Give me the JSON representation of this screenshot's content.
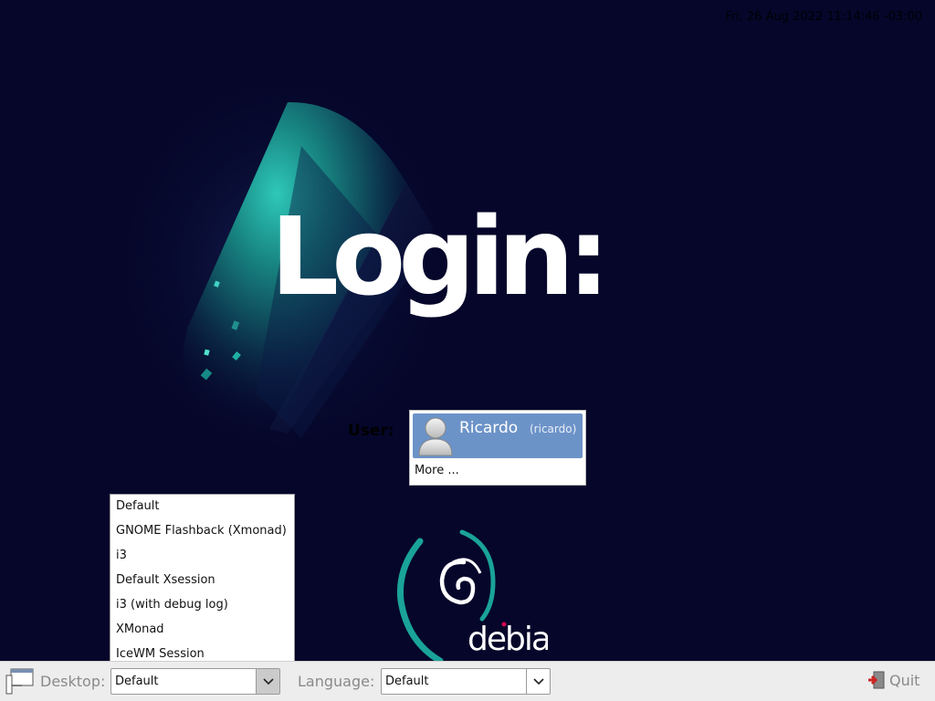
{
  "clock": "Fri, 26 Aug 2022 11:14:46 -03:00",
  "login_title": "Login:",
  "user_label": "User:",
  "user_list": {
    "selected_user": {
      "name": "Ricardo",
      "login": "(ricardo)"
    },
    "more_label": "More ..."
  },
  "session_menu": {
    "items": [
      "Default",
      "GNOME Flashback (Xmonad)",
      "i3",
      "Default Xsession",
      "i3 (with debug log)",
      "XMonad",
      "IceWM Session"
    ]
  },
  "bottom_bar": {
    "desktop_label": "Desktop:",
    "desktop_value": "Default",
    "language_label": "Language:",
    "language_value": "Default",
    "quit_label": "Quit"
  },
  "logo_text": "debian",
  "icons": {
    "panel": "panel-window-icon",
    "avatar": "user-avatar-icon",
    "quit": "exit-door-icon",
    "dropdown": "chevron-down-icon"
  },
  "colors": {
    "background": "#05062a",
    "teal_accent": "#1aa39a",
    "user_highlight": "#6c93c8",
    "panel": "#ededed"
  }
}
